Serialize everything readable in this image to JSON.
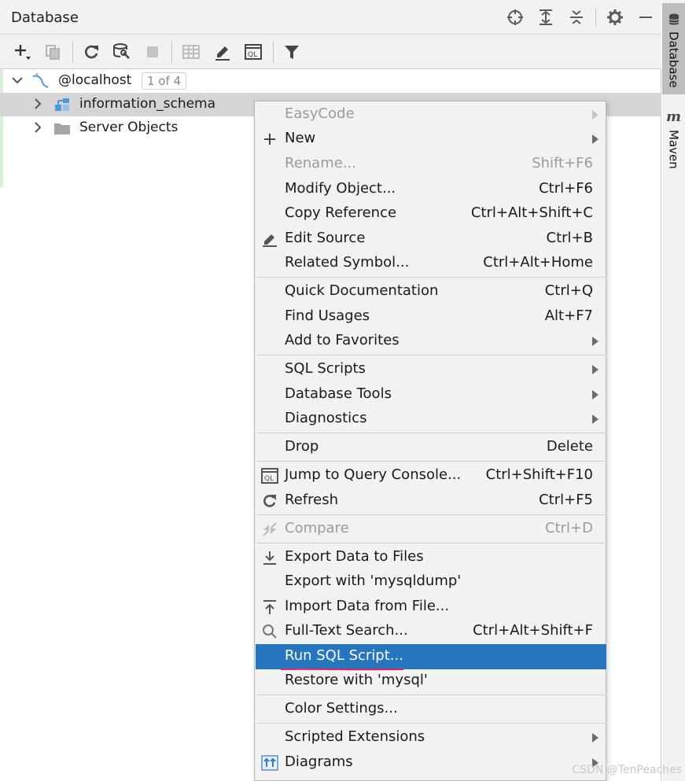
{
  "header": {
    "title": "Database"
  },
  "header_icons": [
    "crosshair-icon",
    "expand-all-icon",
    "collapse-all-icon",
    "gear-icon",
    "minimize-icon"
  ],
  "toolbar": {
    "items": [
      "add-icon",
      "duplicate-icon",
      "refresh-icon",
      "schema-properties-icon",
      "stop-icon",
      "table-editor-icon",
      "edit-icon",
      "query-console-icon",
      "filter-icon"
    ]
  },
  "tree": {
    "root": {
      "label": "@localhost",
      "counter": "1 of 4"
    },
    "children": [
      {
        "label": "information_schema",
        "selected": true
      },
      {
        "label": "Server Objects",
        "selected": false
      }
    ]
  },
  "sidebar": {
    "tabs": [
      {
        "label": "Database",
        "active": true
      },
      {
        "label": "Maven",
        "active": false
      }
    ]
  },
  "context_menu": {
    "items": {
      "easycode": {
        "label": "EasyCode"
      },
      "new": {
        "label": "New"
      },
      "rename": {
        "label": "Rename...",
        "shortcut": "Shift+F6"
      },
      "modify": {
        "label": "Modify Object...",
        "shortcut": "Ctrl+F6"
      },
      "copy_ref": {
        "label": "Copy Reference",
        "shortcut": "Ctrl+Alt+Shift+C"
      },
      "edit_source": {
        "label": "Edit Source",
        "shortcut": "Ctrl+B"
      },
      "related": {
        "label": "Related Symbol...",
        "shortcut": "Ctrl+Alt+Home"
      },
      "quick_doc": {
        "label": "Quick Documentation",
        "shortcut": "Ctrl+Q"
      },
      "find_usages": {
        "label": "Find Usages",
        "shortcut": "Alt+F7"
      },
      "add_fav": {
        "label": "Add to Favorites"
      },
      "sql_scripts": {
        "label": "SQL Scripts"
      },
      "db_tools": {
        "label": "Database Tools"
      },
      "diagnostics": {
        "label": "Diagnostics"
      },
      "drop": {
        "label": "Drop",
        "shortcut": "Delete"
      },
      "jump_console": {
        "label": "Jump to Query Console...",
        "shortcut": "Ctrl+Shift+F10"
      },
      "refresh": {
        "label": "Refresh",
        "shortcut": "Ctrl+F5"
      },
      "compare": {
        "label": "Compare",
        "shortcut": "Ctrl+D"
      },
      "export_files": {
        "label": "Export Data to Files"
      },
      "export_dump": {
        "label": "Export with 'mysqldump'"
      },
      "import_file": {
        "label": "Import Data from File..."
      },
      "fulltext": {
        "label": "Full-Text Search...",
        "shortcut": "Ctrl+Alt+Shift+F"
      },
      "run_sql": {
        "label": "Run SQL Script..."
      },
      "restore": {
        "label": "Restore with 'mysql'"
      },
      "color_settings": {
        "label": "Color Settings..."
      },
      "scripted_ext": {
        "label": "Scripted Extensions"
      },
      "diagrams": {
        "label": "Diagrams"
      }
    }
  },
  "colors": {
    "highlight": "#2675bf",
    "selection": "#d5d5d5",
    "annotation": "#e0245e"
  },
  "watermark": "CSDN @TenPeaches"
}
